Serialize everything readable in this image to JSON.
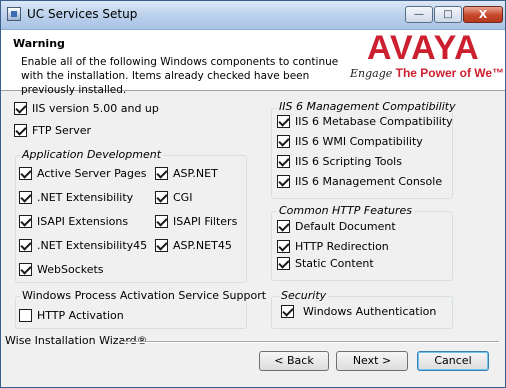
{
  "window": {
    "title": "UC Services Setup",
    "controls": {
      "minimize": "—",
      "maximize": "□",
      "close": "X"
    }
  },
  "header": {
    "title": "Warning",
    "description": "Enable all of the following Windows components to continue with the installation. Items already checked have been previously installed.",
    "logo": {
      "brand": "AVAYA",
      "tag_prefix": "Engage",
      "tag_main": "The Power of We™",
      "color": "#cc1f2f"
    }
  },
  "top_items": [
    {
      "label": "IIS version 5.00 and up",
      "checked": true
    },
    {
      "label": "FTP Server",
      "checked": true
    }
  ],
  "app_dev": {
    "label": "Application Development",
    "items": [
      {
        "label": "Active Server Pages",
        "checked": true
      },
      {
        "label": "ASP.NET",
        "checked": true
      },
      {
        "label": ".NET Extensibility",
        "checked": true
      },
      {
        "label": "CGI",
        "checked": true
      },
      {
        "label": "ISAPI Extensions",
        "checked": true
      },
      {
        "label": "ISAPI Filters",
        "checked": true
      },
      {
        "label": ".NET Extensibility45",
        "checked": true
      },
      {
        "label": "ASP.NET45",
        "checked": true
      },
      {
        "label": "WebSockets",
        "checked": true
      }
    ]
  },
  "wpas": {
    "label": "Windows Process Activation Service Support",
    "items": [
      {
        "label": "HTTP Activation",
        "checked": false
      }
    ]
  },
  "iis6": {
    "label": "IIS 6 Management Compatibility",
    "items": [
      {
        "label": "IIS 6 Metabase Compatibility",
        "checked": true
      },
      {
        "label": "IIS 6 WMI Compatibility",
        "checked": true
      },
      {
        "label": "IIS 6 Scripting Tools",
        "checked": true
      },
      {
        "label": "IIS 6 Management Console",
        "checked": true
      }
    ]
  },
  "http_features": {
    "label": "Common HTTP Features",
    "items": [
      {
        "label": "Default Document",
        "checked": true
      },
      {
        "label": "HTTP Redirection",
        "checked": true
      },
      {
        "label": "Static Content",
        "checked": true
      }
    ]
  },
  "security": {
    "label": "Security",
    "items": [
      {
        "label": "Windows Authentication",
        "checked": true
      }
    ]
  },
  "footer": {
    "wizard_label": "Wise Installation Wizard®",
    "back_label": "< Back",
    "next_label": "Next >",
    "cancel_label": "Cancel"
  }
}
